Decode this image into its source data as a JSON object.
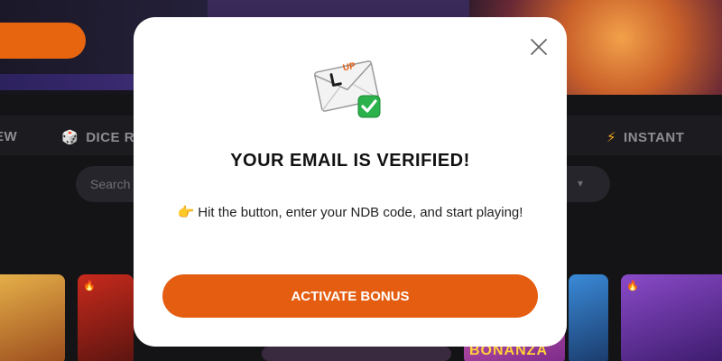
{
  "background": {
    "nav": {
      "item_new": "EW",
      "item_dice": "DICE R",
      "item_instant": "INSTANT"
    },
    "search": {
      "placeholder": "Search"
    },
    "tile_text": "BONANZA"
  },
  "modal": {
    "title": "YOUR EMAIL IS VERIFIED!",
    "message": "Hit the button, enter your NDB code, and start playing!",
    "envelope_badge": "UP",
    "button_label": "ACTIVATE BONUS"
  },
  "icons": {
    "close": "close-icon",
    "envelope": "envelope-icon",
    "check": "check-icon",
    "pointing_hand": "pointing-hand-icon",
    "dice": "dice-icon",
    "bolt": "bolt-icon"
  },
  "colors": {
    "accent": "#e45d10",
    "check_green": "#2bb24c",
    "modal_bg": "#ffffff",
    "page_bg": "#141416"
  }
}
